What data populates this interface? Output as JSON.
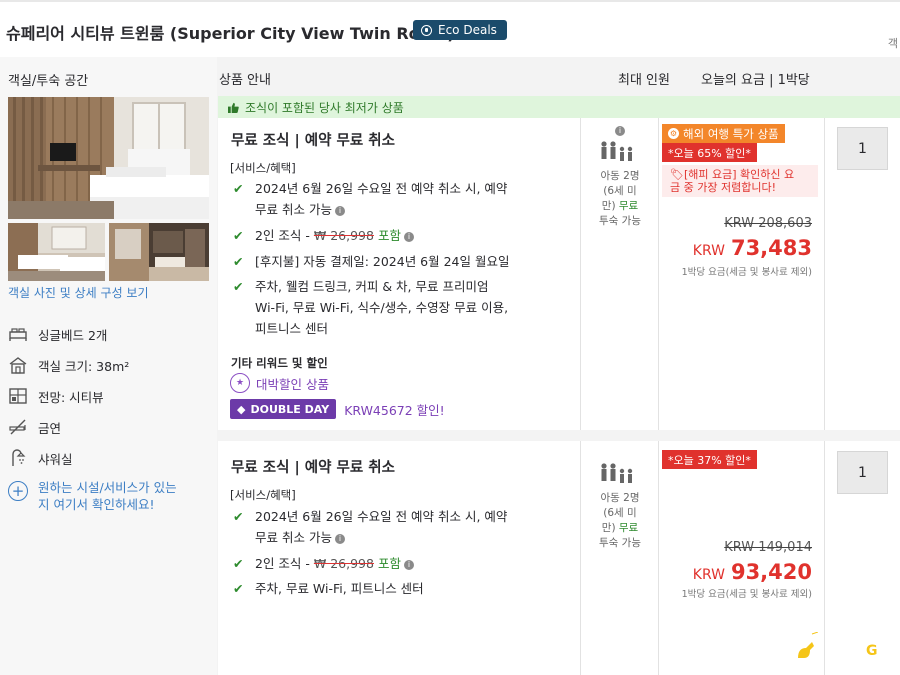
{
  "header": {
    "room_title": "슈페리어 시티뷰 트윈룸 (Superior City View Twin Room)",
    "eco_badge": "Eco Deals",
    "corner_char": "객"
  },
  "sidebar": {
    "section_title": "객실/투숙 공간",
    "photo_link": "객실 사진 및 상세 구성 보기",
    "features": [
      {
        "icon": "bed-icon",
        "label": "싱글베드 2개"
      },
      {
        "icon": "room-size-icon",
        "label": "객실 크기: 38m²"
      },
      {
        "icon": "view-icon",
        "label": "전망: 시티뷰"
      },
      {
        "icon": "no-smoking-icon",
        "label": "금연"
      },
      {
        "icon": "shower-icon",
        "label": "샤워실"
      }
    ],
    "more_line1": "원하는 시설/서비스가 있는",
    "more_line2": "지 여기서 확인하세요!"
  },
  "columns": {
    "product": "상품 안내",
    "max_guests": "최대 인원",
    "today_price": "오늘의 요금 | 1박당"
  },
  "offers": [
    {
      "ribbon": "조식이 포함된 당사 최저가 상품",
      "title": "무료 조식 | 예약 무료 취소",
      "services_label": "[서비스/혜택]",
      "cancel_line1": "2024년 6월 26일 수요일 전 예약 취소 시, 예약",
      "cancel_line2": "무료 취소 가능",
      "breakfast_pre": "2인 조식 - ",
      "breakfast_strike": "₩ 26,998",
      "breakfast_incl": "포함",
      "pay_later": "[후지불] 자동 결제일: 2024년 6월 24일 월요일",
      "amen_line1": "주차, 웰컴 드링크, 커피 & 차, 무료 프리미엄",
      "amen_line2": "Wi-Fi, 무료 Wi-Fi, 식수/생수, 수영장 무료 이용,",
      "amen_line3": "피트니스 센터",
      "other_label": "기타 리워드 및 할인",
      "deal_label": "대박할인 상품",
      "double_day": "DOUBLE DAY",
      "double_day_amt": "KRW45672 할인!",
      "occ_line1": "아동 2명",
      "occ_line2": "(6세 미",
      "occ_line3_pre": "만) ",
      "occ_line3_free": "무료",
      "occ_line4": "투숙 가능",
      "badge_travel": "해외 여행 특가 상품",
      "badge_discount": "*오늘 65% 할인*",
      "hotprice_line1": "[해피 요금] 확인하신 요",
      "hotprice_line2": "금 중 가장 저렴합니다!",
      "orig_price": "KRW 208,603",
      "currency": "KRW",
      "price": "73,483",
      "price_note": "1박당 요금(세금 및 봉사료 제외)",
      "qty": "1"
    },
    {
      "title": "무료 조식 | 예약 무료 취소",
      "services_label": "[서비스/혜택]",
      "cancel_line1": "2024년 6월 26일 수요일 전 예약 취소 시, 예약",
      "cancel_line2": "무료 취소 가능",
      "breakfast_pre": "2인 조식 - ",
      "breakfast_strike": "₩ 26,998",
      "breakfast_incl": "포함",
      "amen_line1": "주차, 무료 Wi-Fi, 피트니스 센터",
      "occ_line1": "아동 2명",
      "occ_line2": "(6세 미",
      "occ_line3_pre": "만) ",
      "occ_line3_free": "무료",
      "occ_line4": "투숙 가능",
      "badge_discount": "*오늘 37% 할인*",
      "orig_price": "KRW 149,014",
      "currency": "KRW",
      "price": "93,420",
      "price_note": "1박당 요금(세금 및 봉사료 제외)",
      "qty": "1"
    }
  ],
  "colors": {
    "primary_text": "#2a2a2e",
    "link_blue": "#3c7ec4",
    "price_red": "#e0322d",
    "check_green": "#2e8b2e",
    "eco_navy": "#1b4b6b",
    "deal_purple": "#6c3aa8",
    "ribbon_green": "#dff5dc",
    "badge_orange": "#f3862a"
  }
}
